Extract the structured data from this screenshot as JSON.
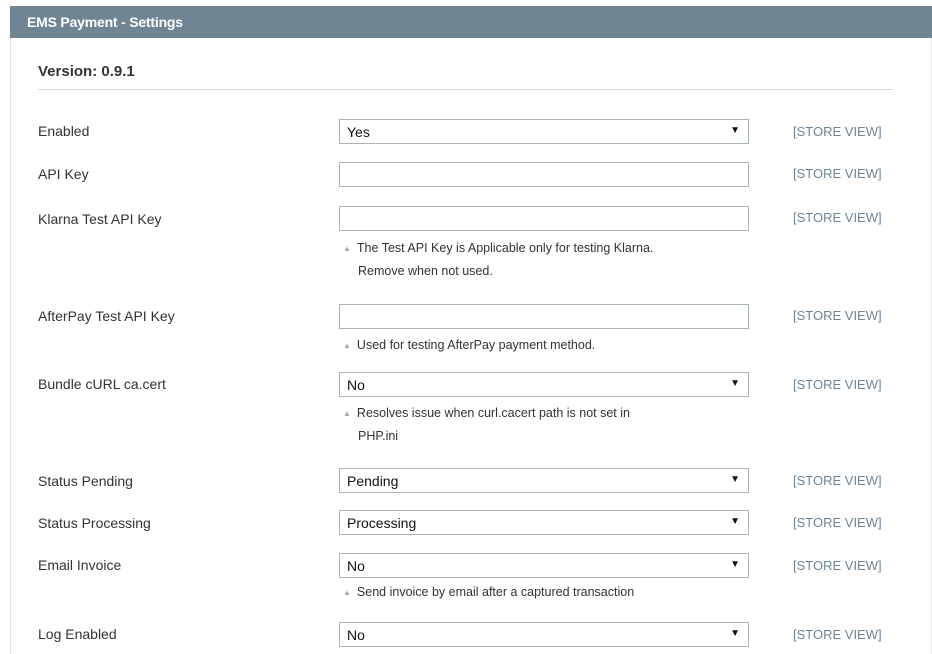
{
  "header": {
    "title": "EMS Payment - Settings"
  },
  "version_label": "Version: 0.9.1",
  "scope_label": "[STORE VIEW]",
  "rows": {
    "enabled": {
      "label": "Enabled",
      "value": "Yes"
    },
    "api_key": {
      "label": "API Key",
      "value": ""
    },
    "klarna": {
      "label": "Klarna Test API Key",
      "value": "",
      "note_line1": "The Test API Key is Applicable only for testing Klarna.",
      "note_line2": "Remove when not used."
    },
    "afterpay": {
      "label": "AfterPay Test API Key",
      "value": "",
      "note_line1": "Used for testing AfterPay payment method."
    },
    "bundle": {
      "label": "Bundle cURL ca.cert",
      "value": "No",
      "note_line1": "Resolves issue when curl.cacert path is not set in",
      "note_line2": "PHP.ini"
    },
    "status_pending": {
      "label": "Status Pending",
      "value": "Pending"
    },
    "status_processing": {
      "label": "Status Processing",
      "value": "Processing"
    },
    "email_invoice": {
      "label": "Email Invoice",
      "value": "No",
      "note_line1": "Send invoice by email after a captured transaction"
    },
    "log_enabled": {
      "label": "Log Enabled",
      "value": "No"
    }
  }
}
